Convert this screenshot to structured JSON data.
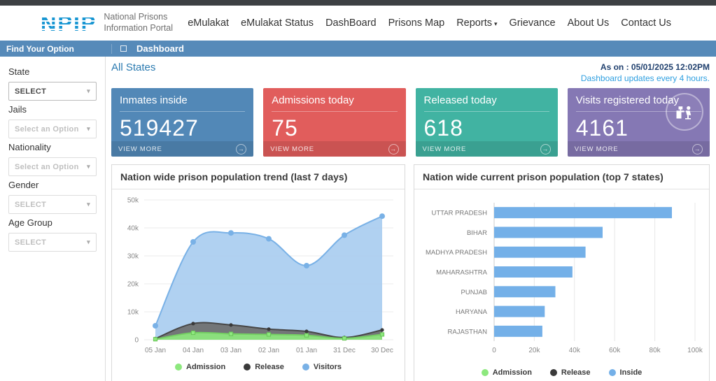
{
  "header": {
    "logo": "NPIP",
    "tagline1": "National Prisons",
    "tagline2": "Information Portal",
    "nav": [
      {
        "label": "eMulakat"
      },
      {
        "label": "eMulakat Status"
      },
      {
        "label": "DashBoard"
      },
      {
        "label": "Prisons Map"
      },
      {
        "label": "Reports"
      },
      {
        "label": "Grievance"
      },
      {
        "label": "About Us"
      },
      {
        "label": "Contact Us"
      }
    ]
  },
  "toolbar": {
    "left_title": "Find Your Option",
    "breadcrumb": "Dashboard"
  },
  "sidebar": {
    "filters": [
      {
        "label": "State",
        "value": "SELECT",
        "enabled": true
      },
      {
        "label": "Jails",
        "value": "Select an Option",
        "enabled": false
      },
      {
        "label": "Nationality",
        "value": "Select an Option",
        "enabled": false
      },
      {
        "label": "Gender",
        "value": "SELECT",
        "enabled": false
      },
      {
        "label": "Age Group",
        "value": "SELECT",
        "enabled": false
      }
    ]
  },
  "content": {
    "scope_title": "All States",
    "as_on": "As on : 05/01/2025 12:02PM",
    "update_note": "Dashboard updates every 4 hours.",
    "cards": [
      {
        "title": "Inmates inside",
        "value": "519427",
        "action": "VIEW MORE",
        "color": "#5288b7",
        "footer_color": "rgba(0,0,0,0.10)"
      },
      {
        "title": "Admissions today",
        "value": "75",
        "action": "VIEW MORE",
        "color": "#e15d5c",
        "footer_color": "rgba(0,0,0,0.10)"
      },
      {
        "title": "Released today",
        "value": "618",
        "action": "VIEW MORE",
        "color": "#41b3a2",
        "footer_color": "rgba(0,0,0,0.10)"
      },
      {
        "title": "Visits registered today",
        "value": "4161",
        "action": "VIEW MORE",
        "color": "#8578b4",
        "footer_color": "rgba(0,0,0,0.10)",
        "icon": "visitor-desk-icon"
      }
    ]
  },
  "icons": {
    "view_more_arrow": "→",
    "caret": "▾"
  },
  "chart_data": [
    {
      "type": "area",
      "title": "Nation wide prison population trend (last 7 days)",
      "x": [
        "05 Jan",
        "04 Jan",
        "03 Jan",
        "02 Jan",
        "01 Jan",
        "31 Dec",
        "30 Dec"
      ],
      "series": [
        {
          "name": "Visitors",
          "color": "#79b1e6",
          "fill": "#a9cdf0",
          "values": [
            5000,
            35000,
            38200,
            36100,
            26500,
            37400,
            44200
          ]
        },
        {
          "name": "Release",
          "color": "#474747",
          "fill": "#6e6e6e",
          "values": [
            400,
            5800,
            5300,
            3800,
            3000,
            800,
            3500
          ]
        },
        {
          "name": "Admission",
          "color": "#74cf63",
          "fill": "#8de87e",
          "values": [
            200,
            2500,
            2100,
            1900,
            1600,
            500,
            1900
          ]
        }
      ],
      "ylim": [
        0,
        50000
      ],
      "yticks": [
        "0",
        "10k",
        "20k",
        "30k",
        "40k",
        "50k"
      ],
      "grid": true,
      "legend_position": "bottom",
      "legend": [
        {
          "name": "Admission",
          "color": "#8de87e"
        },
        {
          "name": "Release",
          "color": "#3a3a3a"
        },
        {
          "name": "Visitors",
          "color": "#79b1e6"
        }
      ]
    },
    {
      "type": "bar",
      "title": "Nation wide current prison population (top 7 states)",
      "orientation": "horizontal",
      "categories": [
        "UTTAR PRADESH",
        "BIHAR",
        "MADHYA PRADESH",
        "MAHARASHTRA",
        "PUNJAB",
        "HARYANA",
        "RAJASTHAN"
      ],
      "values": [
        88500,
        54000,
        45500,
        39000,
        30500,
        25200,
        24000
      ],
      "bar_color": "#74b0e8",
      "xlim": [
        0,
        100000
      ],
      "xticks": [
        "0",
        "20k",
        "40k",
        "60k",
        "80k",
        "100k"
      ],
      "grid": true,
      "legend_position": "bottom",
      "legend": [
        {
          "name": "Admission",
          "color": "#8de87e"
        },
        {
          "name": "Release",
          "color": "#3a3a3a"
        },
        {
          "name": "Inside",
          "color": "#74b0e8"
        }
      ]
    }
  ]
}
